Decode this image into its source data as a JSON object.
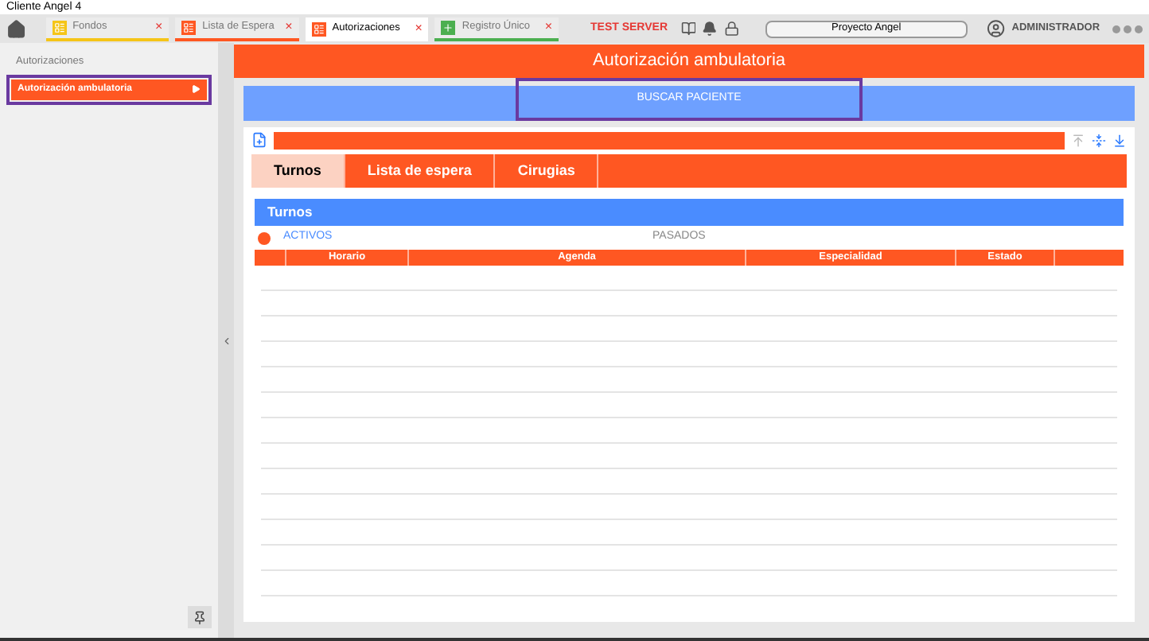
{
  "window": {
    "title": "Cliente Angel 4"
  },
  "doc_tabs": [
    {
      "label": "Fondos",
      "selected": false,
      "color": "#f5c518",
      "close": "×"
    },
    {
      "label": "Lista de Espera",
      "selected": false,
      "color": "#ff5722",
      "close": "×"
    },
    {
      "label": "Autorizaciones",
      "selected": true,
      "color": "#ff5722",
      "close": "×"
    },
    {
      "label": "Registro Único",
      "selected": false,
      "color": "#4caf50",
      "close": "×"
    }
  ],
  "server_label": "TEST SERVER",
  "project_field": {
    "value": "Proyecto Angel"
  },
  "user": {
    "name": "ADMINISTRADOR"
  },
  "sidebar": {
    "section": "Autorizaciones",
    "items": [
      {
        "label": "Autorización ambulatoria",
        "selected": true
      }
    ]
  },
  "page_title": "Autorización ambulatoria",
  "search_button": "BUSCAR PACIENTE",
  "tabs": [
    {
      "label": "Turnos",
      "selected": true
    },
    {
      "label": "Lista de espera",
      "selected": false
    },
    {
      "label": "Cirugias",
      "selected": false
    }
  ],
  "panel_title": "Turnos",
  "filters": [
    {
      "label": "ACTIVOS",
      "selected": true
    },
    {
      "label": "PASADOS",
      "selected": false
    }
  ],
  "table": {
    "columns": [
      "Horario",
      "Agenda",
      "Especialidad",
      "Estado"
    ]
  }
}
